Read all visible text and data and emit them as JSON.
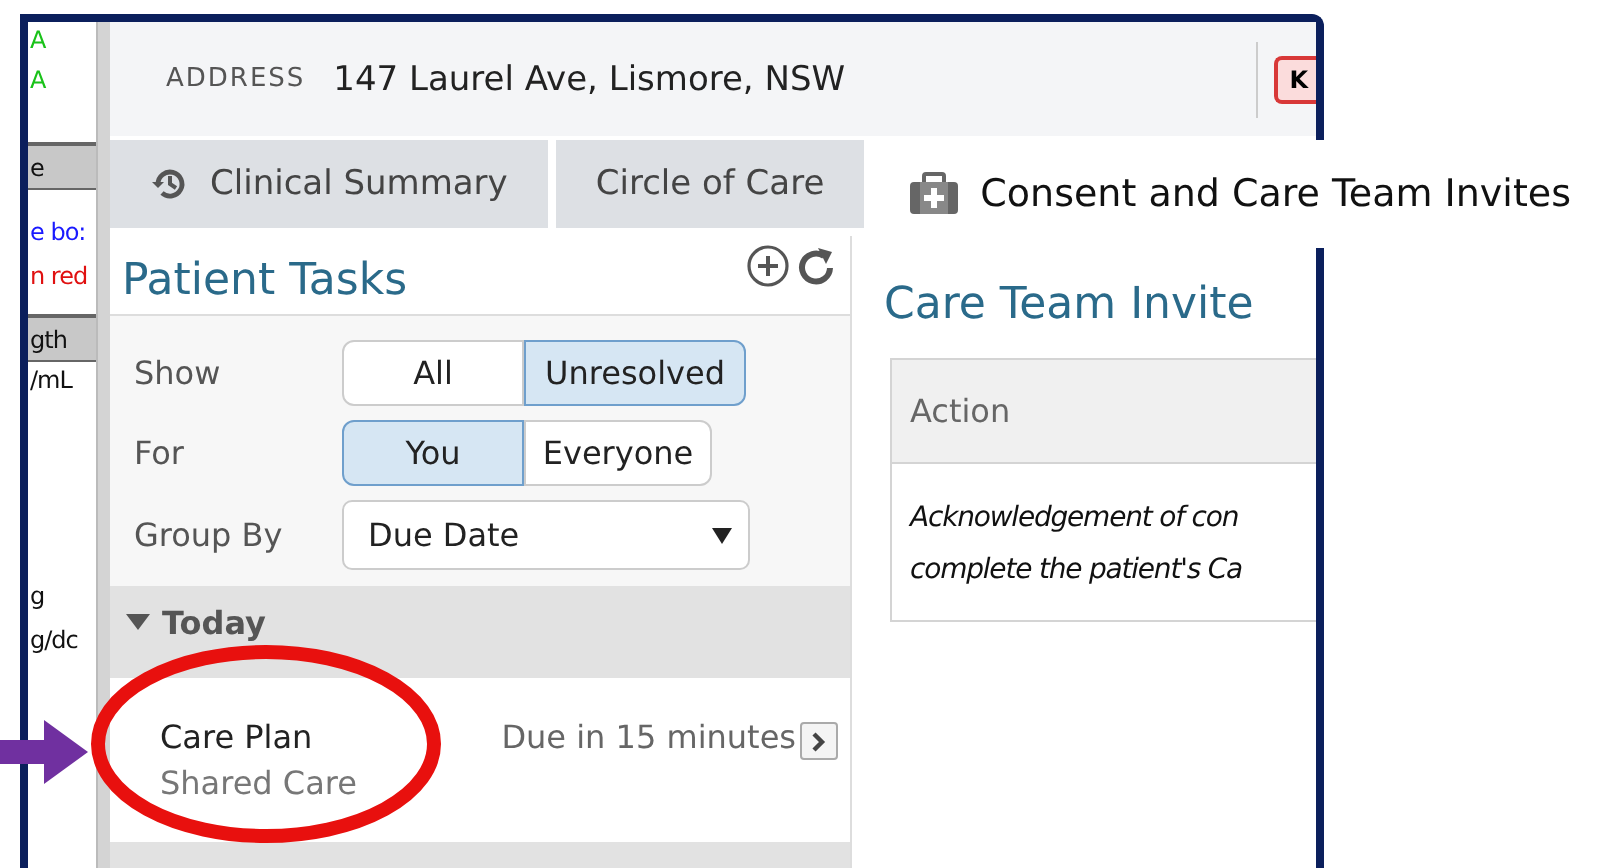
{
  "side_strip": {
    "items": [
      {
        "text": "A",
        "kind": "status"
      },
      {
        "text": "A",
        "kind": "status"
      },
      {
        "text": "e",
        "kind": "header"
      },
      {
        "text": "e bo:",
        "kind": "link"
      },
      {
        "text": "n red",
        "kind": "alert"
      },
      {
        "text": "gth",
        "kind": "header"
      },
      {
        "text": "/mL",
        "kind": "plain"
      },
      {
        "text": "g",
        "kind": "plain"
      },
      {
        "text": "g/dc",
        "kind": "plain"
      }
    ]
  },
  "header": {
    "label": "ADDRESS",
    "value": "147 Laurel Ave, Lismore, NSW",
    "badge": "K"
  },
  "tabs": [
    {
      "label": "Clinical Summary",
      "selected": false
    },
    {
      "label": "Circle of Care",
      "selected": false
    },
    {
      "label": "Consent and Care Team Invites",
      "selected": true
    }
  ],
  "tasks_panel": {
    "title": "Patient Tasks",
    "filters": [
      {
        "label": "Show",
        "kind": "toggle",
        "options": [
          {
            "label": "All",
            "selected": false
          },
          {
            "label": "Unresolved",
            "selected": true
          }
        ]
      },
      {
        "label": "For",
        "kind": "toggle",
        "options": [
          {
            "label": "You",
            "selected": true
          },
          {
            "label": "Everyone",
            "selected": false
          }
        ]
      },
      {
        "label": "Group By",
        "kind": "select",
        "value": "Due Date"
      }
    ],
    "groups": [
      {
        "label": "Today",
        "expanded": true,
        "tasks": [
          {
            "title": "Care Plan",
            "subtitle": "Shared Care",
            "due": "Due in 15 minutes"
          }
        ]
      }
    ]
  },
  "content": {
    "title": "Care Team Invite",
    "table": {
      "columns": [
        "Action"
      ],
      "rows": [
        [
          "Acknowledgement of con\ncomplete the patient's Ca"
        ]
      ]
    }
  }
}
